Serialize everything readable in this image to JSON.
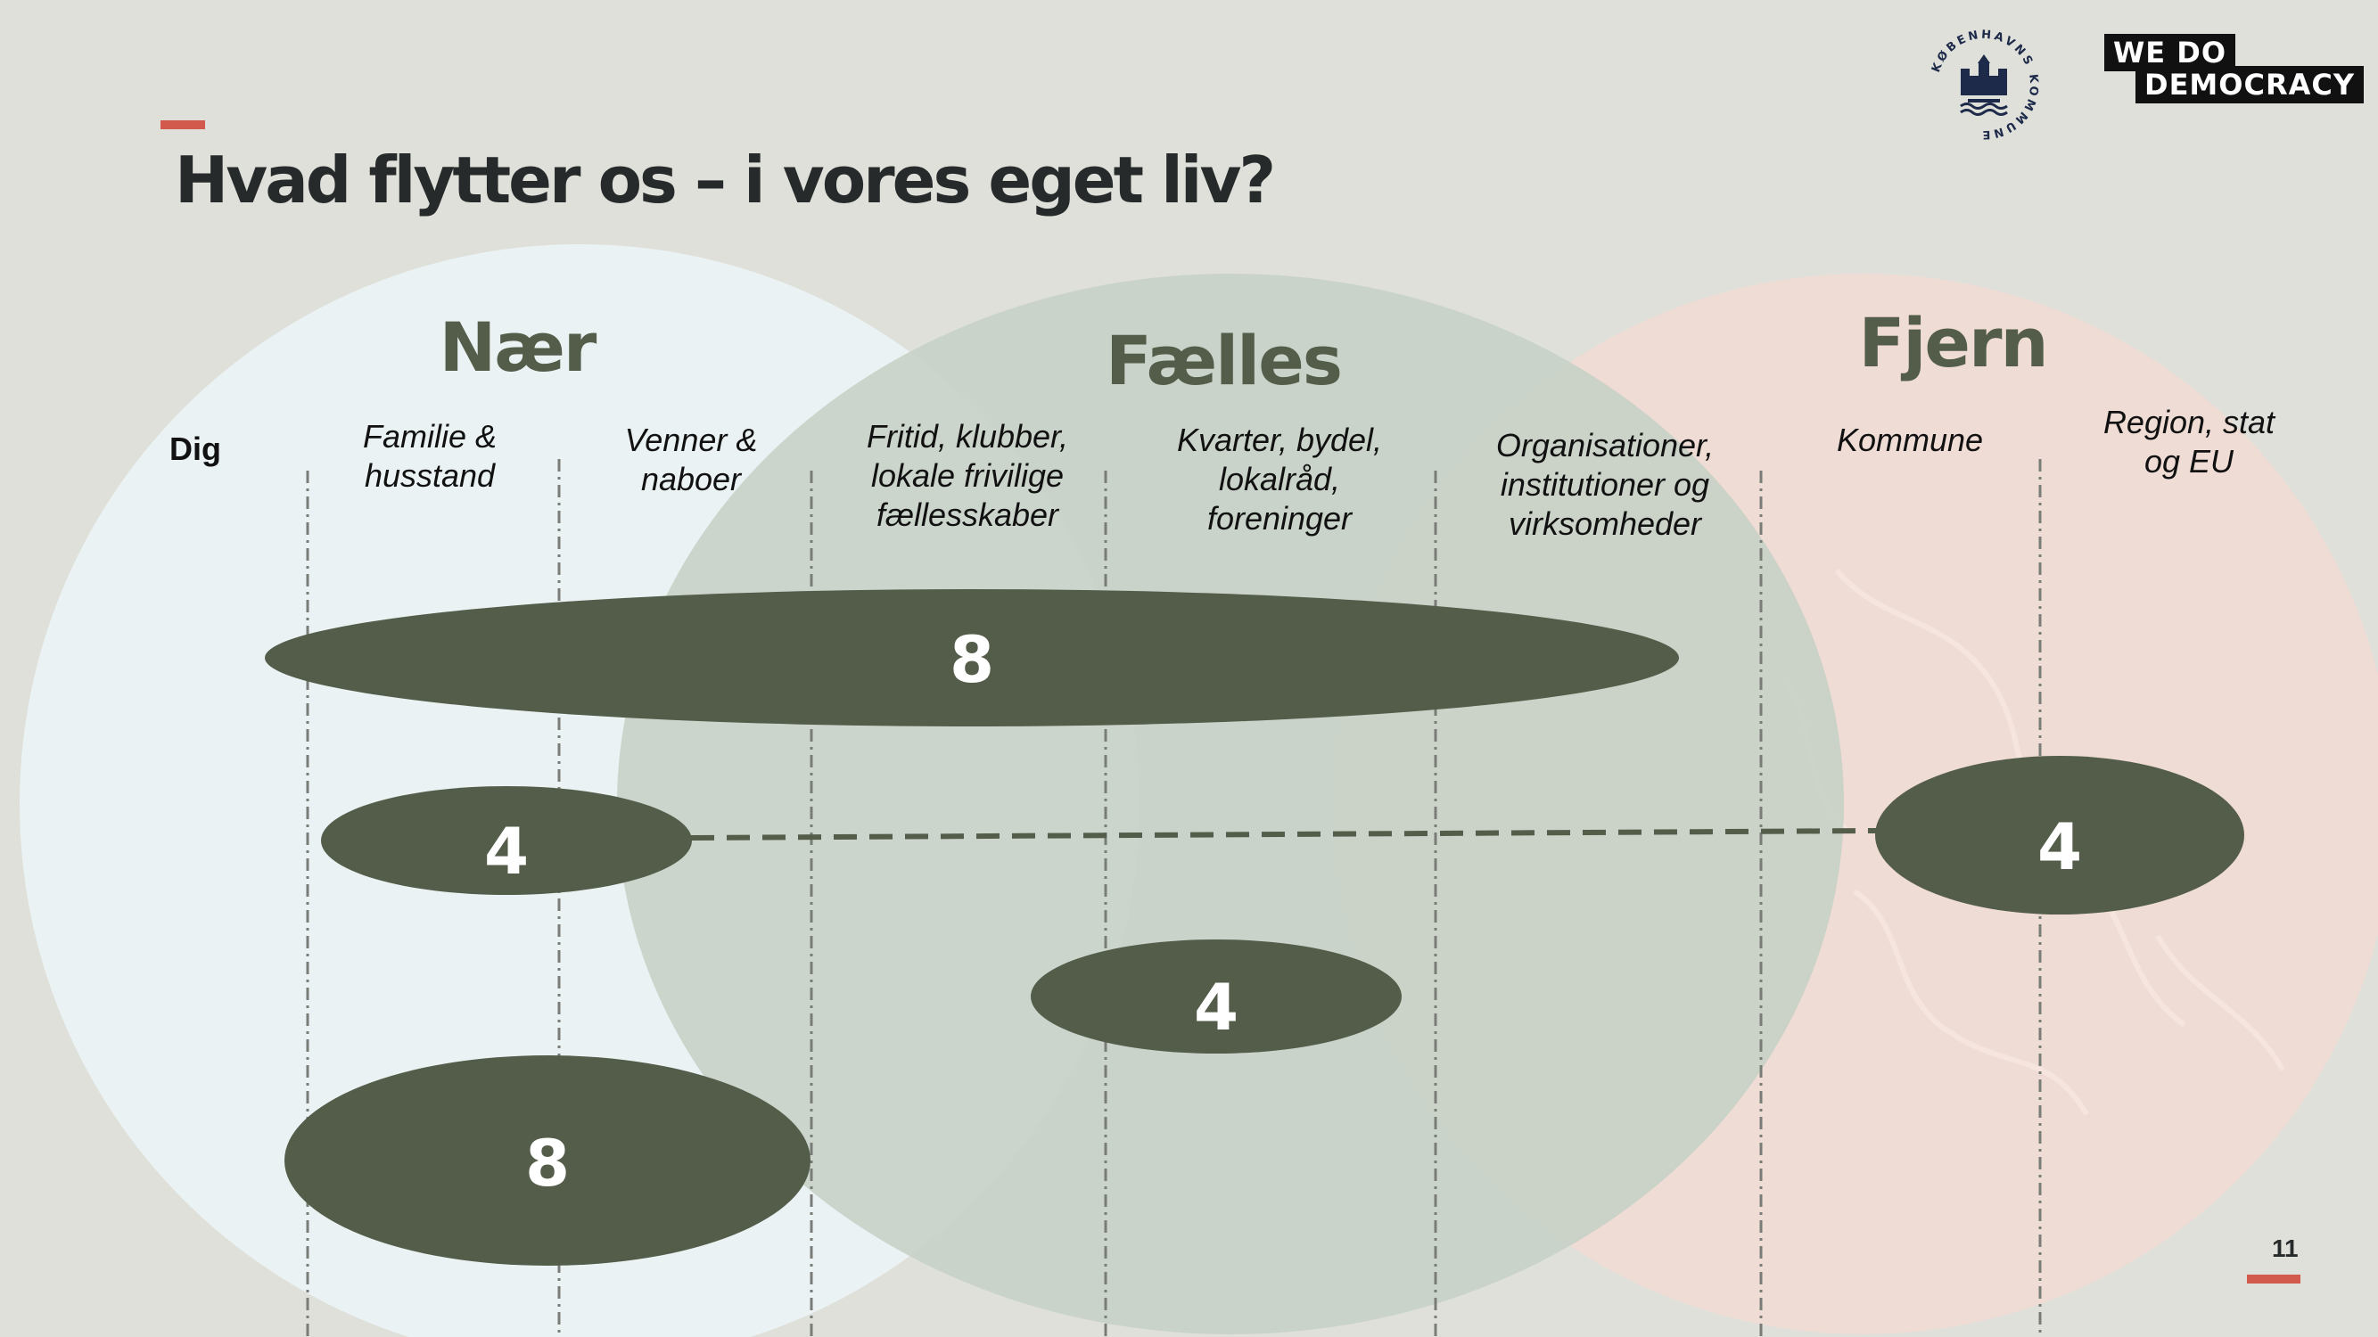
{
  "slide": {
    "title": "Hvad flytter os – i vores eget liv?",
    "page_number": "11"
  },
  "logos": {
    "seal_text": "KØBENHAVNS KOMMUNE",
    "democracy_line1": "WE DO",
    "democracy_line2": "DEMOCRACY"
  },
  "zones": [
    {
      "label": "Nær",
      "color": "#eaf2f3"
    },
    {
      "label": "Fælles",
      "color": "#c6d0c6"
    },
    {
      "label": "Fjern",
      "color": "#efdcd5"
    }
  ],
  "columns": [
    {
      "label": "Dig"
    },
    {
      "label": "Familie &\nhusstand"
    },
    {
      "label": "Venner &\nnaboer"
    },
    {
      "label": "Fritid, klubber,\nlokale frivilige\nfællesskaber"
    },
    {
      "label": "Kvarter, bydel,\nlokalråd,\nforeninger"
    },
    {
      "label": "Organisationer,\ninstitutioner og\nvirksomheder"
    },
    {
      "label": "Kommune"
    },
    {
      "label": "Region, stat\nog EU"
    }
  ],
  "groups": [
    {
      "value": "8",
      "from_column": 1,
      "to_column": 5
    },
    {
      "value": "4",
      "from_column": 1,
      "to_column": 2,
      "linked_to": 4
    },
    {
      "value": "4",
      "from_column": 7,
      "to_column": 7
    },
    {
      "value": "4",
      "from_column": 4,
      "to_column": 4
    },
    {
      "value": "8",
      "from_column": 1,
      "to_column": 2
    }
  ],
  "colors": {
    "ellipse": "#535d4a",
    "accent": "#d25a4c",
    "title": "#272a2b"
  }
}
